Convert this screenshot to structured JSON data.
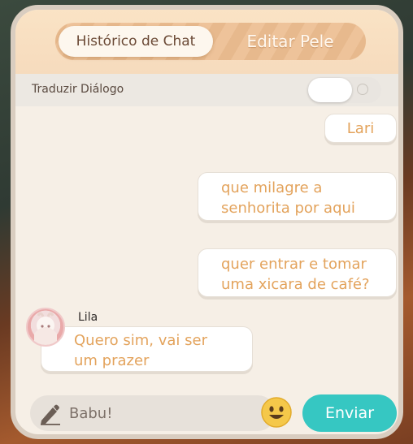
{
  "tabs": {
    "active_label": "Histórico de Chat",
    "inactive_label": "Editar Pele"
  },
  "translate": {
    "label": "Traduzir Diálogo",
    "enabled": false
  },
  "messages": {
    "player_name": "Lari",
    "outgoing": [
      {
        "line1": "que milagre a",
        "line2": "senhorita por aqui"
      },
      {
        "line1": "quer entrar e tomar",
        "line2": "uma xicara de café?"
      }
    ],
    "incoming": {
      "speaker": "Lila",
      "line1": "Quero sim, vai ser",
      "line2": "um prazer"
    }
  },
  "composer": {
    "value": "Babu!",
    "send_label": "Enviar"
  },
  "icons": {
    "edit": "pencil-icon",
    "emoji": "smiley-emoji-icon",
    "avatar": "character-avatar"
  },
  "colors": {
    "accent": "#36c7c2",
    "bubble_text": "#e3a35c",
    "panel_bg": "#f6efe6",
    "header_bg": "#fae3c5"
  }
}
